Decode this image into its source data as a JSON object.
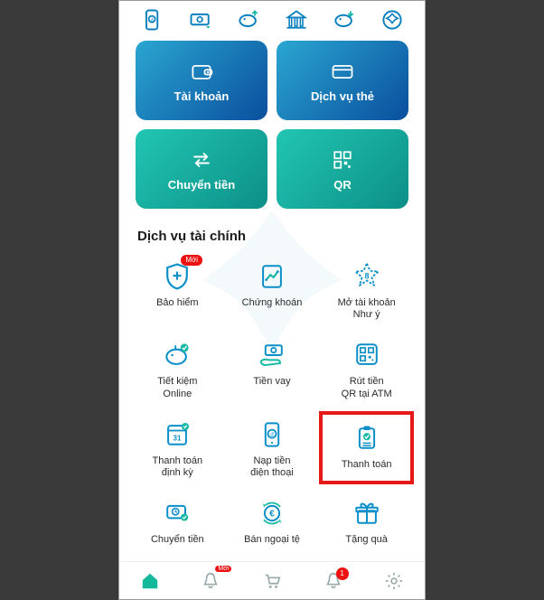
{
  "top_shortcuts": [
    {
      "name": "mobile-topup-icon"
    },
    {
      "name": "cash-transfer-icon"
    },
    {
      "name": "savings-deposit-icon"
    },
    {
      "name": "bank-building-icon"
    },
    {
      "name": "savings-withdraw-icon"
    },
    {
      "name": "rewards-icon"
    }
  ],
  "tiles": [
    {
      "label": "Tài khoản",
      "name": "account-tile",
      "style": "blue",
      "icon": "wallet"
    },
    {
      "label": "Dịch vụ thẻ",
      "name": "card-services-tile",
      "style": "blue",
      "icon": "card"
    },
    {
      "label": "Chuyển tiền",
      "name": "transfer-tile",
      "style": "teal",
      "icon": "transfer"
    },
    {
      "label": "QR",
      "name": "qr-tile",
      "style": "teal",
      "icon": "qr"
    }
  ],
  "section_title": "Dịch vụ tài chính",
  "services": [
    {
      "label": "Bảo hiểm",
      "name": "insurance",
      "icon": "shield-plus",
      "badge": "Mới"
    },
    {
      "label": "Chứng khoán",
      "name": "securities",
      "icon": "chart"
    },
    {
      "label": "Mở tài khoản\nNhư ý",
      "name": "open-account",
      "icon": "star-8"
    },
    {
      "label": "Tiết kiệm\nOnline",
      "name": "savings-online",
      "icon": "piggy-check"
    },
    {
      "label": "Tiền vay",
      "name": "loan",
      "icon": "hand-cash"
    },
    {
      "label": "Rút tiền\nQR tại ATM",
      "name": "qr-atm",
      "icon": "qr-cash"
    },
    {
      "label": "Thanh toán\nđịnh kỳ",
      "name": "recurring-payment",
      "icon": "calendar-31"
    },
    {
      "label": "Nạp tiền\nđiện thoại",
      "name": "mobile-topup",
      "icon": "phone-d"
    },
    {
      "label": "Thanh toán",
      "name": "payment",
      "icon": "invoice-check",
      "highlight": true
    },
    {
      "label": "Chuyển tiền",
      "name": "scheduled-transfer",
      "icon": "clock-card"
    },
    {
      "label": "Bán ngoại tệ",
      "name": "sell-fx",
      "icon": "euro-cycle"
    },
    {
      "label": "Tặng quà",
      "name": "gift",
      "icon": "gift"
    }
  ],
  "bottom_nav": [
    {
      "name": "home",
      "active": true
    },
    {
      "name": "notifications",
      "badge_text": "Mới"
    },
    {
      "name": "cart"
    },
    {
      "name": "alerts",
      "badge_count": "1"
    },
    {
      "name": "settings"
    }
  ]
}
